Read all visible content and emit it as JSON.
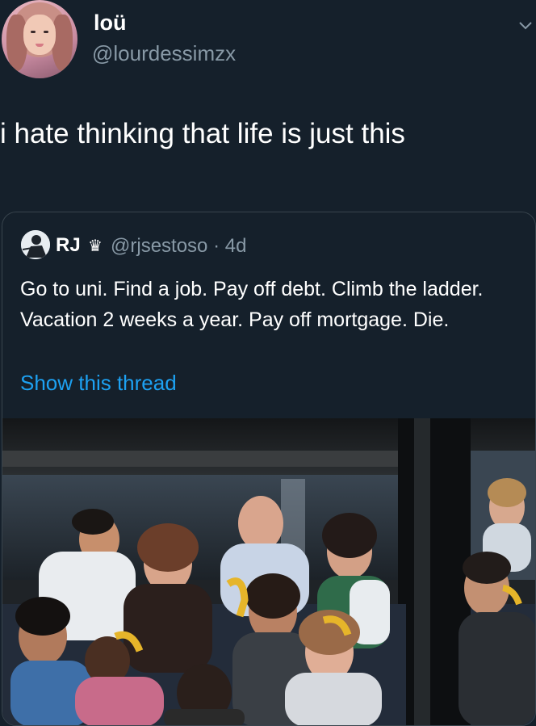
{
  "author": {
    "display_name": "loü",
    "handle": "@lourdessimzx",
    "avatar_icon": "profile-photo"
  },
  "tweet": {
    "text": "i hate thinking that life is just this"
  },
  "menu": {
    "icon": "chevron-down-icon"
  },
  "quoted": {
    "display_name": "RJ",
    "badge": "♛",
    "meta": "@rjsestoso · 4d",
    "text": "Go to uni. Find a job. Pay off debt. Climb the ladder. Vacation 2 weeks a year. Pay off mortgage. Die.",
    "show_thread": "Show this thread",
    "media": "photo-commuters-on-train"
  },
  "colors": {
    "background": "#15202b",
    "secondary_text": "#8899a6",
    "link": "#1da1f2",
    "border": "#38444d"
  }
}
